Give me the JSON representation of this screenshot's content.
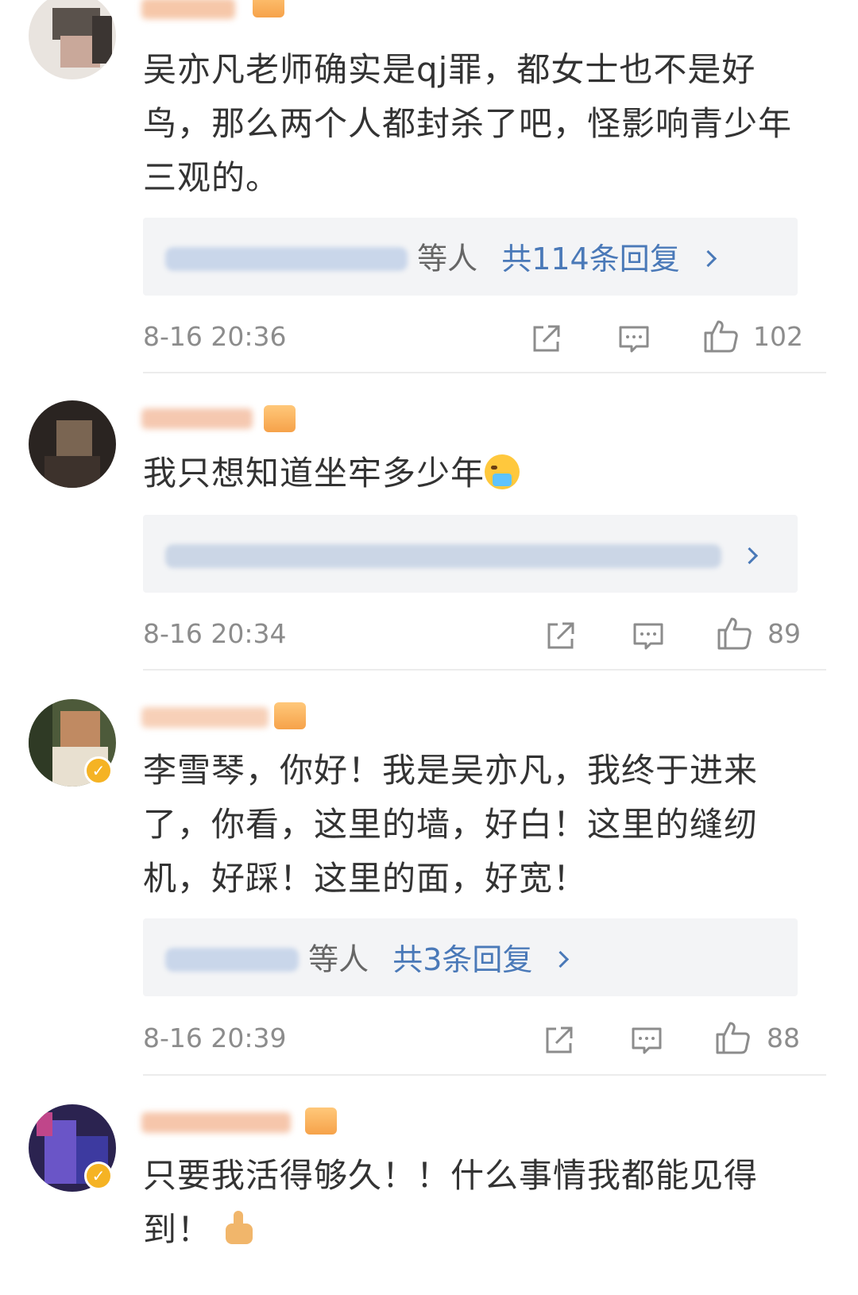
{
  "comments": [
    {
      "text": "吴亦凡老师确实是qj罪，都女士也不是好鸟，那么两个人都封杀了吧，怪影响青少年三观的。",
      "reply_suffix": "等人",
      "reply_link": "共114条回复",
      "timestamp": "8-16 20:36",
      "likes": "102"
    },
    {
      "text": "我只想知道坐牢多少年",
      "emoji": "cry-emoji",
      "timestamp": "8-16 20:34",
      "likes": "89"
    },
    {
      "text": "李雪琴，你好！我是吴亦凡，我终于进来了，你看，这里的墙，好白！这里的缝纫机，好踩！这里的面，好宽！",
      "reply_suffix": "等人",
      "reply_link": "共3条回复",
      "timestamp": "8-16 20:39",
      "likes": "88"
    },
    {
      "text": "只要我活得够久！！什么事情我都能见得到！",
      "emoji": "thumbs-up-emoji"
    }
  ],
  "colors": {
    "text": "#333333",
    "meta": "#8c8c8c",
    "link": "#4a79b8",
    "reply_bg": "#f3f4f6",
    "verified_badge": "#f5b324"
  },
  "icons": [
    "share-icon",
    "comment-icon",
    "like-icon",
    "chevron-right-icon",
    "verified-icon"
  ]
}
